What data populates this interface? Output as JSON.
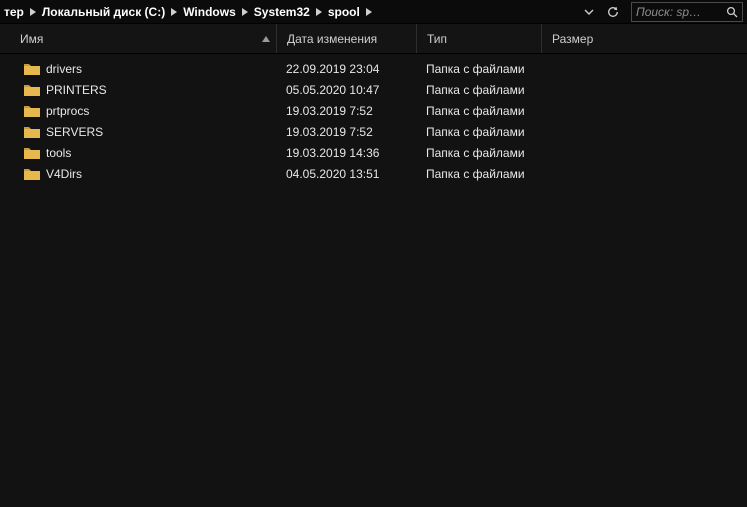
{
  "breadcrumb": {
    "items": [
      {
        "label": "тер"
      },
      {
        "label": "Локальный диск (C:)"
      },
      {
        "label": "Windows"
      },
      {
        "label": "System32"
      },
      {
        "label": "spool"
      }
    ]
  },
  "search": {
    "placeholder": "Поиск: sp…"
  },
  "columns": {
    "name": "Имя",
    "date": "Дата изменения",
    "type": "Тип",
    "size": "Размер"
  },
  "rows": [
    {
      "name": "drivers",
      "date": "22.09.2019 23:04",
      "type": "Папка с файлами",
      "size": ""
    },
    {
      "name": "PRINTERS",
      "date": "05.05.2020 10:47",
      "type": "Папка с файлами",
      "size": ""
    },
    {
      "name": "prtprocs",
      "date": "19.03.2019 7:52",
      "type": "Папка с файлами",
      "size": ""
    },
    {
      "name": "SERVERS",
      "date": "19.03.2019 7:52",
      "type": "Папка с файлами",
      "size": ""
    },
    {
      "name": "tools",
      "date": "19.03.2019 14:36",
      "type": "Папка с файлами",
      "size": ""
    },
    {
      "name": "V4Dirs",
      "date": "04.05.2020 13:51",
      "type": "Папка с файлами",
      "size": ""
    }
  ],
  "colors": {
    "folder": "#e6b84e",
    "folder_back": "#c89a38"
  }
}
